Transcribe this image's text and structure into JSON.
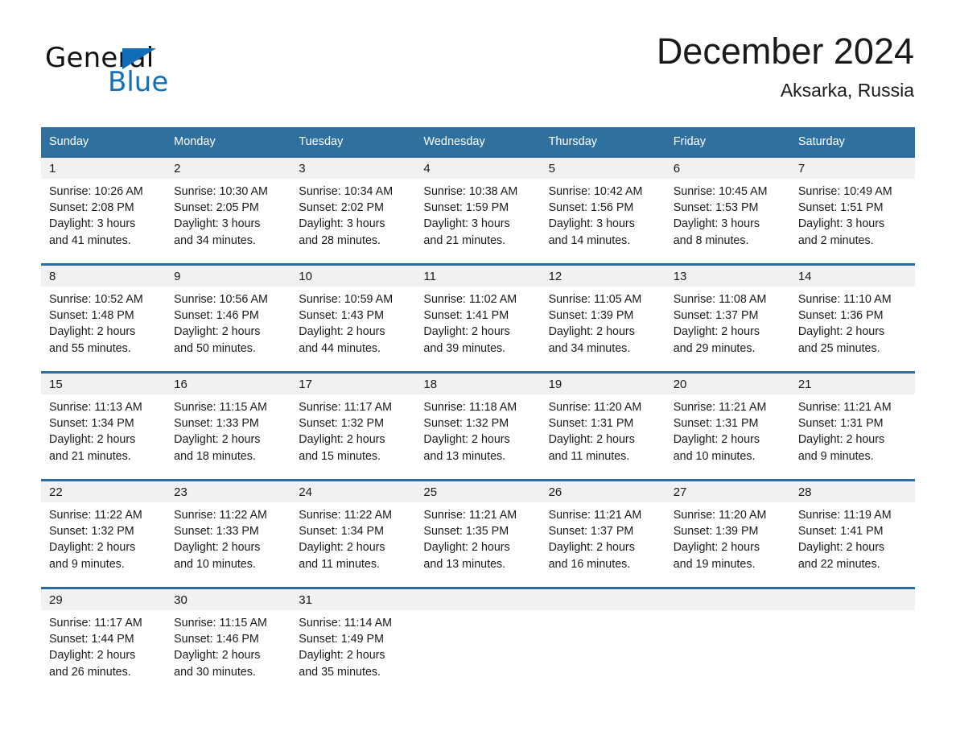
{
  "brand": {
    "name_part1": "General",
    "name_part2": "Blue",
    "accent_color": "#1170bb"
  },
  "header": {
    "title": "December 2024",
    "location": "Aksarka, Russia"
  },
  "theme": {
    "header_row_bg": "#30709e",
    "row_separator": "#2b6ca3",
    "daynum_band_bg": "#f1f1f1"
  },
  "weekdays": [
    "Sunday",
    "Monday",
    "Tuesday",
    "Wednesday",
    "Thursday",
    "Friday",
    "Saturday"
  ],
  "labels": {
    "sunrise_prefix": "Sunrise:",
    "sunset_prefix": "Sunset:",
    "daylight_prefix": "Daylight:"
  },
  "weeks": [
    [
      {
        "day": "1",
        "sunrise": "Sunrise: 10:26 AM",
        "sunset": "Sunset: 2:08 PM",
        "daylight_line1": "Daylight: 3 hours",
        "daylight_line2": "and 41 minutes."
      },
      {
        "day": "2",
        "sunrise": "Sunrise: 10:30 AM",
        "sunset": "Sunset: 2:05 PM",
        "daylight_line1": "Daylight: 3 hours",
        "daylight_line2": "and 34 minutes."
      },
      {
        "day": "3",
        "sunrise": "Sunrise: 10:34 AM",
        "sunset": "Sunset: 2:02 PM",
        "daylight_line1": "Daylight: 3 hours",
        "daylight_line2": "and 28 minutes."
      },
      {
        "day": "4",
        "sunrise": "Sunrise: 10:38 AM",
        "sunset": "Sunset: 1:59 PM",
        "daylight_line1": "Daylight: 3 hours",
        "daylight_line2": "and 21 minutes."
      },
      {
        "day": "5",
        "sunrise": "Sunrise: 10:42 AM",
        "sunset": "Sunset: 1:56 PM",
        "daylight_line1": "Daylight: 3 hours",
        "daylight_line2": "and 14 minutes."
      },
      {
        "day": "6",
        "sunrise": "Sunrise: 10:45 AM",
        "sunset": "Sunset: 1:53 PM",
        "daylight_line1": "Daylight: 3 hours",
        "daylight_line2": "and 8 minutes."
      },
      {
        "day": "7",
        "sunrise": "Sunrise: 10:49 AM",
        "sunset": "Sunset: 1:51 PM",
        "daylight_line1": "Daylight: 3 hours",
        "daylight_line2": "and 2 minutes."
      }
    ],
    [
      {
        "day": "8",
        "sunrise": "Sunrise: 10:52 AM",
        "sunset": "Sunset: 1:48 PM",
        "daylight_line1": "Daylight: 2 hours",
        "daylight_line2": "and 55 minutes."
      },
      {
        "day": "9",
        "sunrise": "Sunrise: 10:56 AM",
        "sunset": "Sunset: 1:46 PM",
        "daylight_line1": "Daylight: 2 hours",
        "daylight_line2": "and 50 minutes."
      },
      {
        "day": "10",
        "sunrise": "Sunrise: 10:59 AM",
        "sunset": "Sunset: 1:43 PM",
        "daylight_line1": "Daylight: 2 hours",
        "daylight_line2": "and 44 minutes."
      },
      {
        "day": "11",
        "sunrise": "Sunrise: 11:02 AM",
        "sunset": "Sunset: 1:41 PM",
        "daylight_line1": "Daylight: 2 hours",
        "daylight_line2": "and 39 minutes."
      },
      {
        "day": "12",
        "sunrise": "Sunrise: 11:05 AM",
        "sunset": "Sunset: 1:39 PM",
        "daylight_line1": "Daylight: 2 hours",
        "daylight_line2": "and 34 minutes."
      },
      {
        "day": "13",
        "sunrise": "Sunrise: 11:08 AM",
        "sunset": "Sunset: 1:37 PM",
        "daylight_line1": "Daylight: 2 hours",
        "daylight_line2": "and 29 minutes."
      },
      {
        "day": "14",
        "sunrise": "Sunrise: 11:10 AM",
        "sunset": "Sunset: 1:36 PM",
        "daylight_line1": "Daylight: 2 hours",
        "daylight_line2": "and 25 minutes."
      }
    ],
    [
      {
        "day": "15",
        "sunrise": "Sunrise: 11:13 AM",
        "sunset": "Sunset: 1:34 PM",
        "daylight_line1": "Daylight: 2 hours",
        "daylight_line2": "and 21 minutes."
      },
      {
        "day": "16",
        "sunrise": "Sunrise: 11:15 AM",
        "sunset": "Sunset: 1:33 PM",
        "daylight_line1": "Daylight: 2 hours",
        "daylight_line2": "and 18 minutes."
      },
      {
        "day": "17",
        "sunrise": "Sunrise: 11:17 AM",
        "sunset": "Sunset: 1:32 PM",
        "daylight_line1": "Daylight: 2 hours",
        "daylight_line2": "and 15 minutes."
      },
      {
        "day": "18",
        "sunrise": "Sunrise: 11:18 AM",
        "sunset": "Sunset: 1:32 PM",
        "daylight_line1": "Daylight: 2 hours",
        "daylight_line2": "and 13 minutes."
      },
      {
        "day": "19",
        "sunrise": "Sunrise: 11:20 AM",
        "sunset": "Sunset: 1:31 PM",
        "daylight_line1": "Daylight: 2 hours",
        "daylight_line2": "and 11 minutes."
      },
      {
        "day": "20",
        "sunrise": "Sunrise: 11:21 AM",
        "sunset": "Sunset: 1:31 PM",
        "daylight_line1": "Daylight: 2 hours",
        "daylight_line2": "and 10 minutes."
      },
      {
        "day": "21",
        "sunrise": "Sunrise: 11:21 AM",
        "sunset": "Sunset: 1:31 PM",
        "daylight_line1": "Daylight: 2 hours",
        "daylight_line2": "and 9 minutes."
      }
    ],
    [
      {
        "day": "22",
        "sunrise": "Sunrise: 11:22 AM",
        "sunset": "Sunset: 1:32 PM",
        "daylight_line1": "Daylight: 2 hours",
        "daylight_line2": "and 9 minutes."
      },
      {
        "day": "23",
        "sunrise": "Sunrise: 11:22 AM",
        "sunset": "Sunset: 1:33 PM",
        "daylight_line1": "Daylight: 2 hours",
        "daylight_line2": "and 10 minutes."
      },
      {
        "day": "24",
        "sunrise": "Sunrise: 11:22 AM",
        "sunset": "Sunset: 1:34 PM",
        "daylight_line1": "Daylight: 2 hours",
        "daylight_line2": "and 11 minutes."
      },
      {
        "day": "25",
        "sunrise": "Sunrise: 11:21 AM",
        "sunset": "Sunset: 1:35 PM",
        "daylight_line1": "Daylight: 2 hours",
        "daylight_line2": "and 13 minutes."
      },
      {
        "day": "26",
        "sunrise": "Sunrise: 11:21 AM",
        "sunset": "Sunset: 1:37 PM",
        "daylight_line1": "Daylight: 2 hours",
        "daylight_line2": "and 16 minutes."
      },
      {
        "day": "27",
        "sunrise": "Sunrise: 11:20 AM",
        "sunset": "Sunset: 1:39 PM",
        "daylight_line1": "Daylight: 2 hours",
        "daylight_line2": "and 19 minutes."
      },
      {
        "day": "28",
        "sunrise": "Sunrise: 11:19 AM",
        "sunset": "Sunset: 1:41 PM",
        "daylight_line1": "Daylight: 2 hours",
        "daylight_line2": "and 22 minutes."
      }
    ],
    [
      {
        "day": "29",
        "sunrise": "Sunrise: 11:17 AM",
        "sunset": "Sunset: 1:44 PM",
        "daylight_line1": "Daylight: 2 hours",
        "daylight_line2": "and 26 minutes."
      },
      {
        "day": "30",
        "sunrise": "Sunrise: 11:15 AM",
        "sunset": "Sunset: 1:46 PM",
        "daylight_line1": "Daylight: 2 hours",
        "daylight_line2": "and 30 minutes."
      },
      {
        "day": "31",
        "sunrise": "Sunrise: 11:14 AM",
        "sunset": "Sunset: 1:49 PM",
        "daylight_line1": "Daylight: 2 hours",
        "daylight_line2": "and 35 minutes."
      },
      {
        "day": "",
        "sunrise": "",
        "sunset": "",
        "daylight_line1": "",
        "daylight_line2": "",
        "empty": true
      },
      {
        "day": "",
        "sunrise": "",
        "sunset": "",
        "daylight_line1": "",
        "daylight_line2": "",
        "empty": true
      },
      {
        "day": "",
        "sunrise": "",
        "sunset": "",
        "daylight_line1": "",
        "daylight_line2": "",
        "empty": true
      },
      {
        "day": "",
        "sunrise": "",
        "sunset": "",
        "daylight_line1": "",
        "daylight_line2": "",
        "empty": true
      }
    ]
  ]
}
